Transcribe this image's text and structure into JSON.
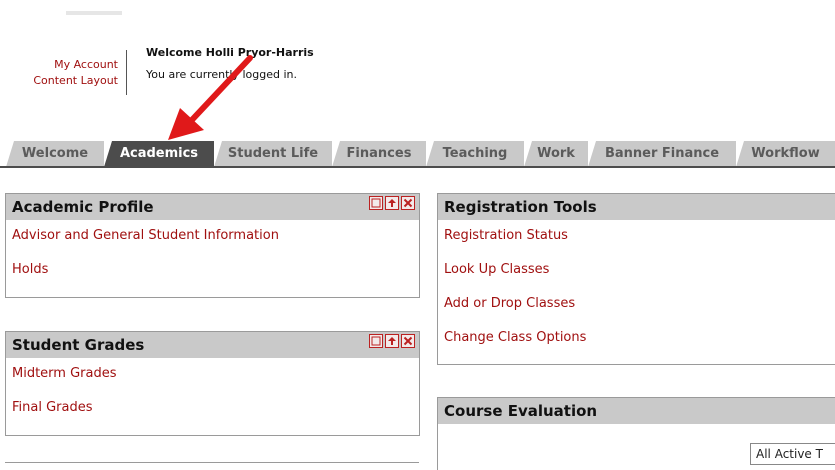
{
  "header": {
    "account_links": [
      "My Account",
      "Content Layout"
    ],
    "welcome": "Welcome Holli Pryor-Harris",
    "logged_in": "You are currently logged in."
  },
  "tabs": [
    {
      "label": "Welcome",
      "active": false
    },
    {
      "label": "Academics",
      "active": true
    },
    {
      "label": "Student Life",
      "active": false
    },
    {
      "label": "Finances",
      "active": false
    },
    {
      "label": "Teaching",
      "active": false
    },
    {
      "label": "Work",
      "active": false
    },
    {
      "label": "Banner Finance",
      "active": false
    },
    {
      "label": "Workflow",
      "active": false
    }
  ],
  "channels": {
    "academic_profile": {
      "title": "Academic Profile",
      "links": [
        "Advisor and General Student Information",
        "Holds"
      ]
    },
    "student_grades": {
      "title": "Student Grades",
      "links": [
        "Midterm Grades",
        "Final Grades"
      ]
    },
    "registration_tools": {
      "title": "Registration Tools",
      "links": [
        "Registration Status",
        "Look Up Classes",
        "Add or Drop Classes",
        "Change Class Options"
      ]
    },
    "course_evaluation": {
      "title": "Course Evaluation",
      "select_value": "All Active T"
    }
  },
  "colors": {
    "link": "#a01010",
    "tab_inactive": "#c9c9c9",
    "tab_active": "#4c4c4c",
    "channel_header": "#c9c9c9",
    "arrow": "#e0191a"
  }
}
